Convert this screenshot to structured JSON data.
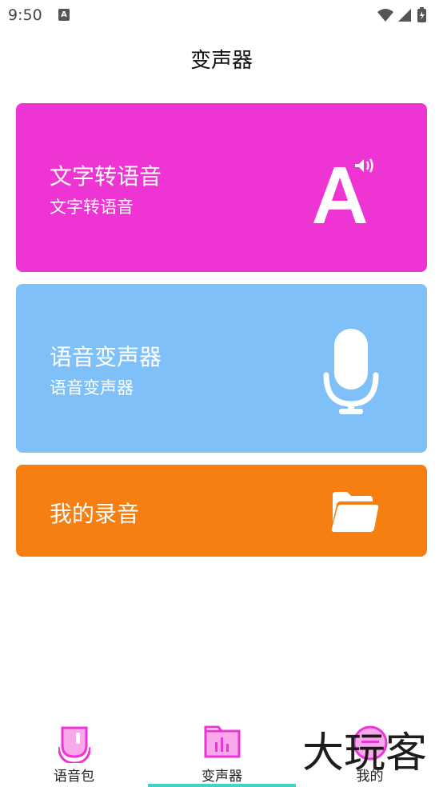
{
  "status_bar": {
    "time": "9:50",
    "app_icon": "A"
  },
  "header": {
    "title": "变声器"
  },
  "cards": {
    "tts": {
      "title": "文字转语音",
      "subtitle": "文字转语音",
      "color": "#ee35d4",
      "icon": "text-to-speech-icon"
    },
    "voice_changer": {
      "title": "语音变声器",
      "subtitle": "语音变声器",
      "color": "#80c0f8",
      "icon": "microphone-icon"
    },
    "my_recordings": {
      "title": "我的录音",
      "color": "#f77f12",
      "icon": "folder-icon"
    }
  },
  "bottom_nav": {
    "items": [
      {
        "label": "语音包",
        "icon": "voice-pack-icon"
      },
      {
        "label": "变声器",
        "icon": "voice-changer-icon",
        "selected": true
      },
      {
        "label": "我的",
        "icon": "profile-icon"
      }
    ],
    "accent": "#ee35d4",
    "indicator_color": "#3fd4c8"
  },
  "watermark": {
    "text": "大玩客"
  }
}
